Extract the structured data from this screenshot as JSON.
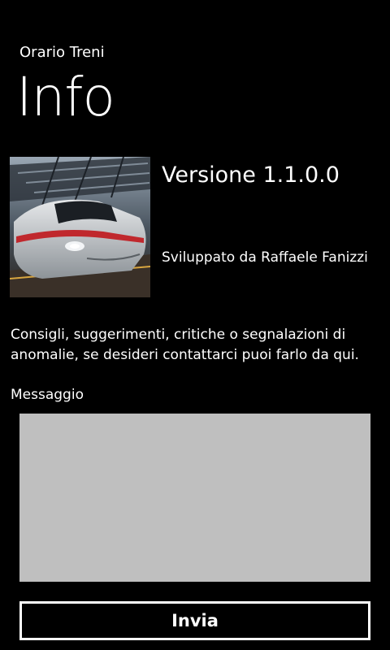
{
  "header": {
    "app_title": "Orario Treni",
    "page_title": "Info"
  },
  "about": {
    "image_description": "train-photo",
    "version": "Versione 1.1.0.0",
    "developer": "Sviluppato da Raffaele Fanizzi"
  },
  "feedback": {
    "description": "Consigli, suggerimenti, critiche o segnalazioni di anomalie, se desideri contattarci puoi farlo da qui.",
    "message_label": "Messaggio",
    "message_value": "",
    "send_label": "Invia"
  },
  "colors": {
    "background": "#000000",
    "text": "#ffffff",
    "input_background": "#bfbfbf",
    "accent_red": "#c0282d"
  }
}
